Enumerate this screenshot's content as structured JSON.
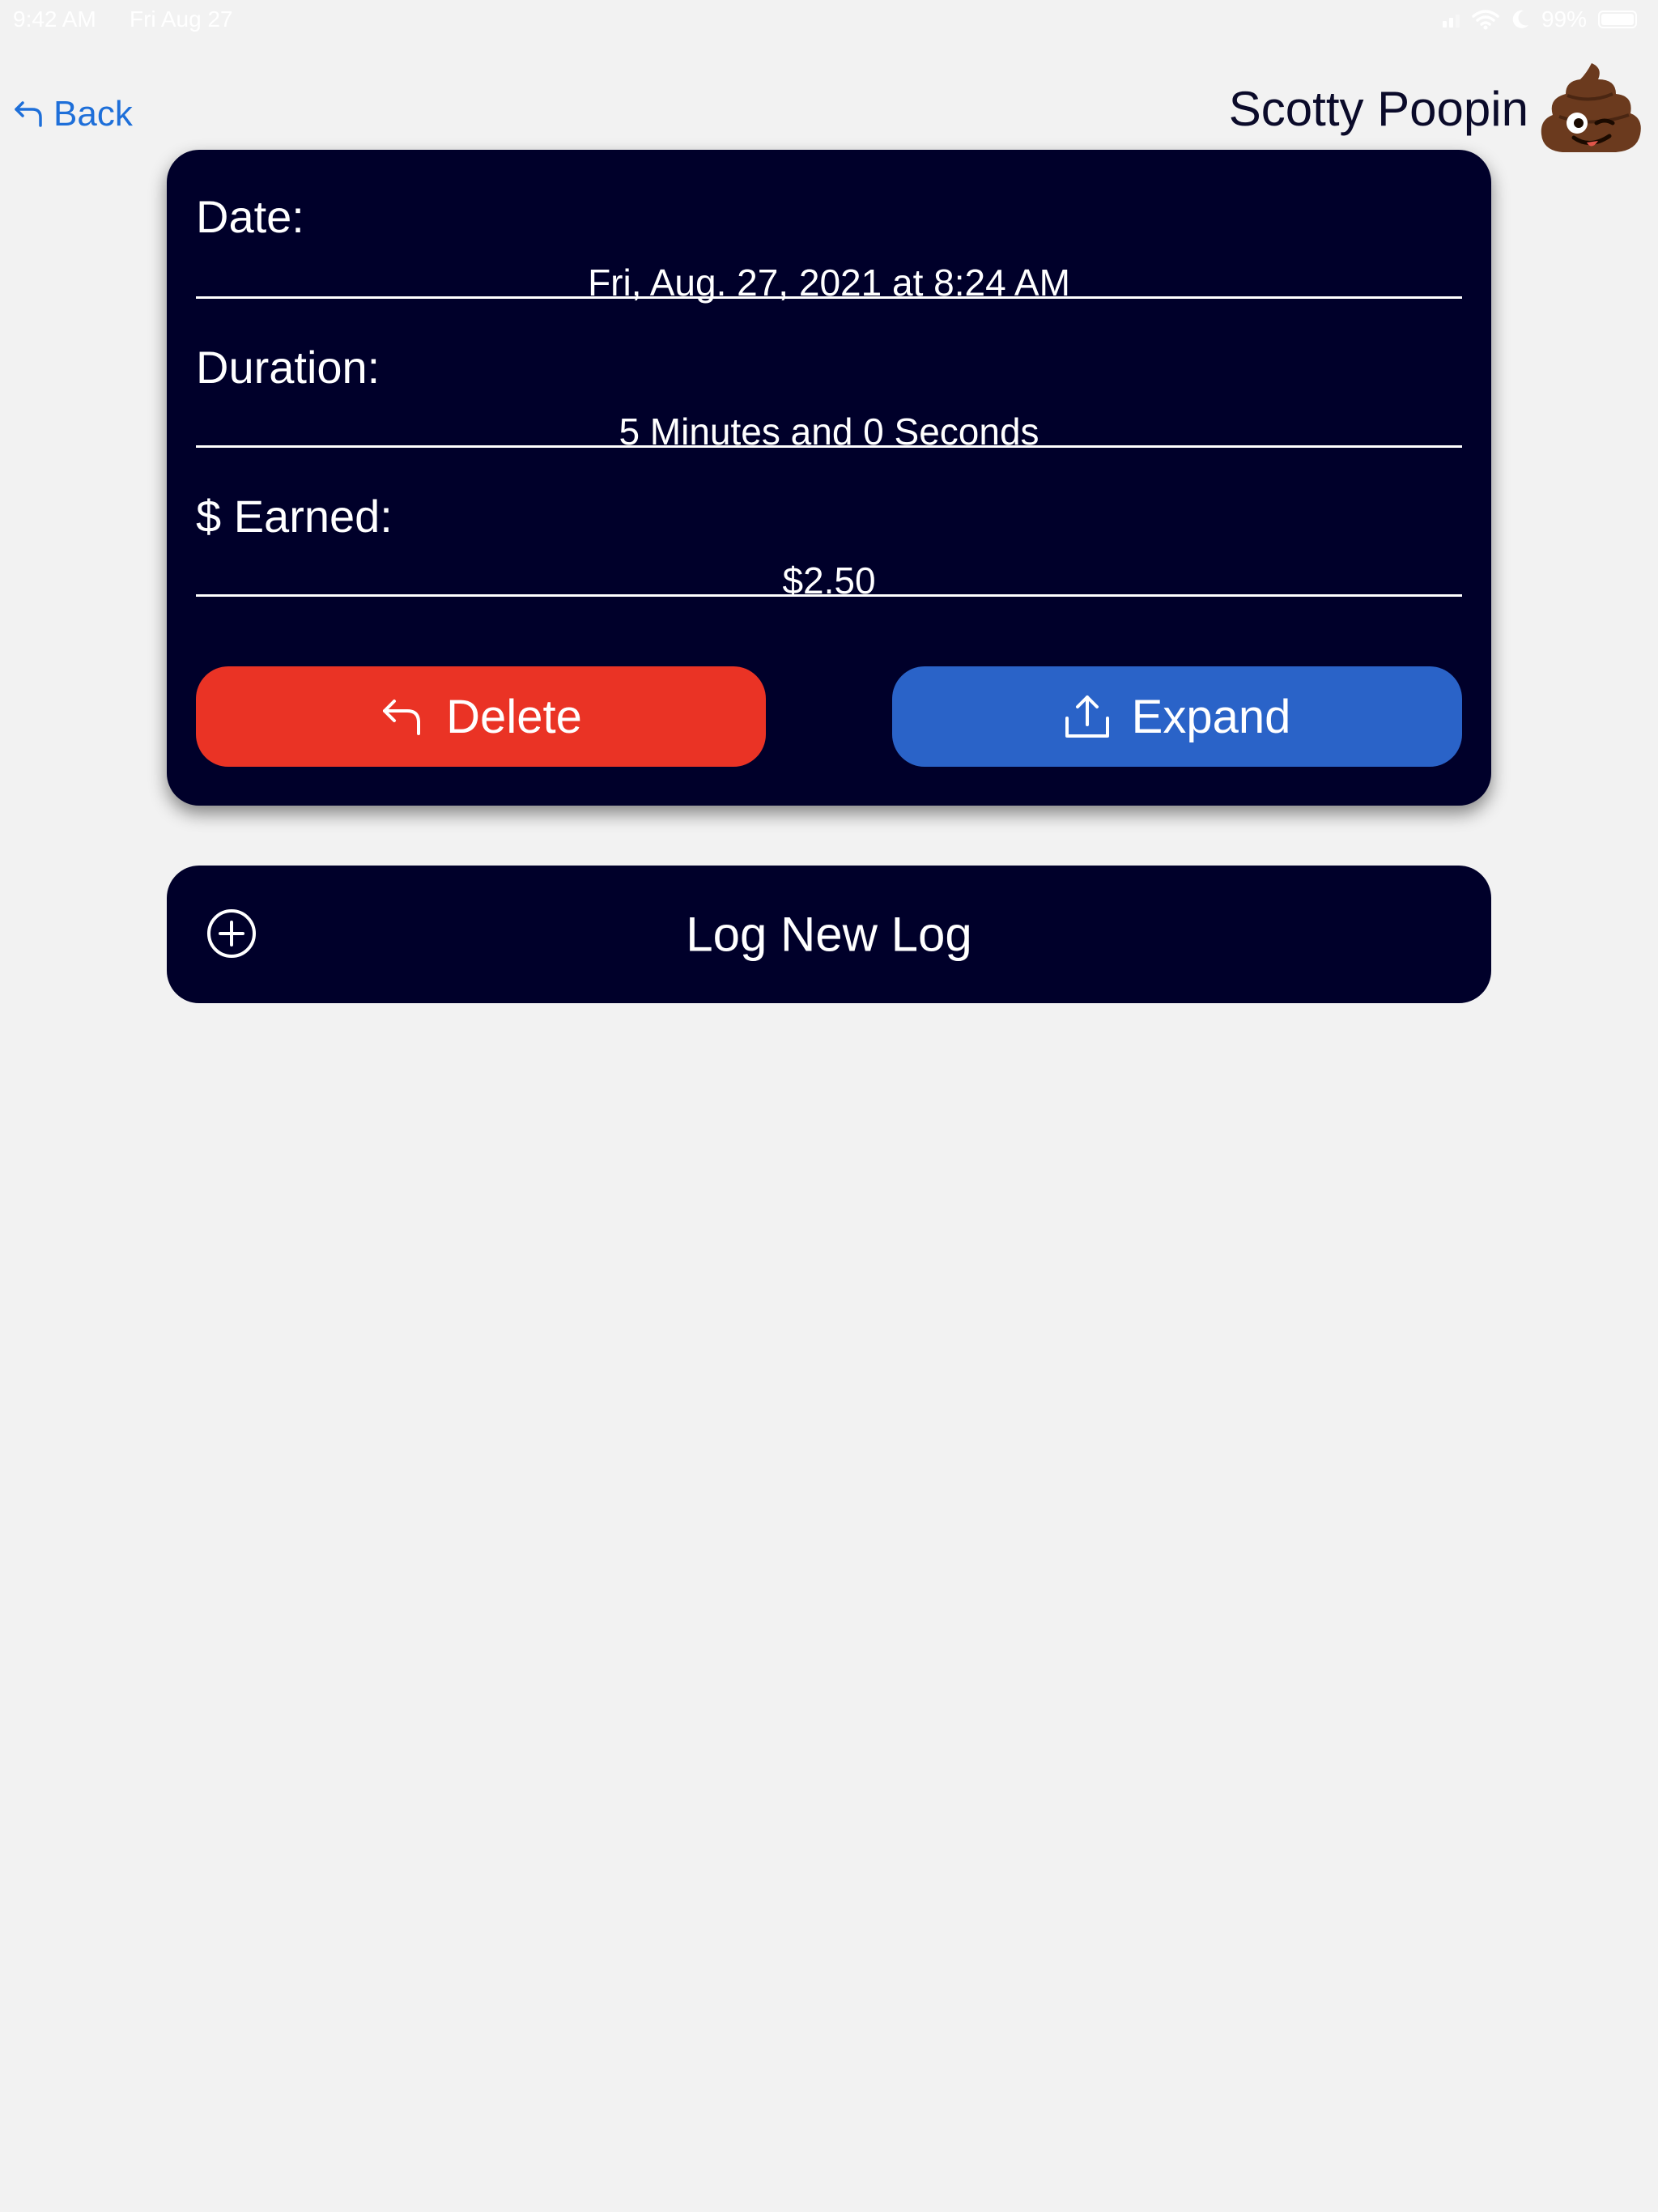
{
  "status_bar": {
    "time": "9:42 AM",
    "date": "Fri Aug 27",
    "battery": "99%",
    "battery_level": 0.99,
    "icons": [
      "signal-icon",
      "wifi-icon",
      "moon-icon",
      "battery-icon"
    ]
  },
  "nav": {
    "back_label": "Back",
    "accent_color": "#1e6fd9"
  },
  "header": {
    "user_name": "Scotty Poopin",
    "avatar_icon": "poop-emoji-icon"
  },
  "log": {
    "date_label": "Date:",
    "date_value": "Fri, Aug. 27, 2021 at 8:24 AM",
    "duration_label": "Duration:",
    "duration_value": "5 Minutes and 0 Seconds",
    "earned_label": "$ Earned:",
    "earned_value": "$2.50",
    "card_color": "#00002a"
  },
  "actions": {
    "delete_label": "Delete",
    "delete_color": "#ea3325",
    "expand_label": "Expand",
    "expand_color": "#2a63c8"
  },
  "new_log": {
    "label": "Log New Log"
  }
}
